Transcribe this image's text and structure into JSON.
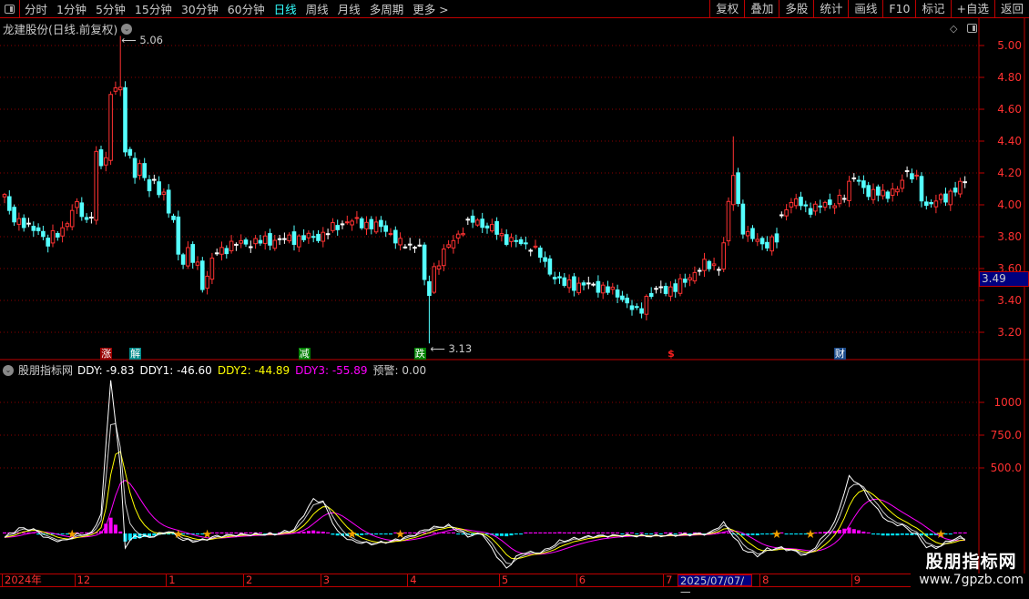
{
  "toolbar": {
    "periods": [
      "分时",
      "1分钟",
      "5分钟",
      "15分钟",
      "30分钟",
      "60分钟",
      "日线",
      "周线",
      "月线",
      "多周期",
      "更多 >"
    ],
    "active_period": "日线",
    "right_buttons": [
      "复权",
      "叠加",
      "多股",
      "统计",
      "画线",
      "F10",
      "标记",
      "+自选",
      "返回"
    ]
  },
  "main_chart": {
    "title": "龙建股份(日线.前复权)",
    "price_axis": [
      "5.00",
      "4.80",
      "4.60",
      "4.40",
      "4.20",
      "4.00",
      "3.80",
      "3.60",
      "3.40",
      "3.20"
    ],
    "current_price": "3.49",
    "high_label": "5.06",
    "low_label": "3.13",
    "signals": [
      {
        "text": "涨",
        "bar": 21,
        "bg": "#9a0000"
      },
      {
        "text": "解",
        "bar": 27,
        "bg": "#008b8b"
      },
      {
        "text": "减",
        "bar": 62,
        "bg": "#008000"
      },
      {
        "text": "跌",
        "bar": 86,
        "bg": "#008000"
      },
      {
        "text": "$",
        "bar": 138,
        "bg": "transparent"
      },
      {
        "text": "财",
        "bar": 173,
        "bg": "#1a4a8a"
      }
    ],
    "price_keyframes": [
      [
        0,
        4.05
      ],
      [
        1,
        3.95
      ],
      [
        3,
        3.9
      ],
      [
        5,
        3.85
      ],
      [
        7,
        3.85
      ],
      [
        8,
        3.8
      ],
      [
        9,
        3.75
      ],
      [
        10,
        3.8
      ],
      [
        12,
        3.85
      ],
      [
        14,
        3.95
      ],
      [
        15,
        4.0
      ],
      [
        17,
        3.9
      ],
      [
        18,
        3.95
      ],
      [
        19,
        4.3
      ],
      [
        20,
        4.25
      ],
      [
        21,
        4.3
      ],
      [
        22,
        4.7
      ],
      [
        23,
        4.75
      ],
      [
        24,
        4.7
      ],
      [
        25,
        4.35
      ],
      [
        26,
        4.3
      ],
      [
        27,
        4.2
      ],
      [
        28,
        4.25
      ],
      [
        29,
        4.15
      ],
      [
        30,
        4.1
      ],
      [
        31,
        4.15
      ],
      [
        32,
        4.1
      ],
      [
        33,
        4.05
      ],
      [
        34,
        3.95
      ],
      [
        35,
        3.9
      ],
      [
        36,
        3.7
      ],
      [
        37,
        3.65
      ],
      [
        38,
        3.7
      ],
      [
        39,
        3.65
      ],
      [
        40,
        3.62
      ],
      [
        41,
        3.5
      ],
      [
        42,
        3.55
      ],
      [
        43,
        3.65
      ],
      [
        44,
        3.7
      ],
      [
        47,
        3.75
      ],
      [
        56,
        3.78
      ],
      [
        65,
        3.8
      ],
      [
        71,
        3.9
      ],
      [
        75,
        3.88
      ],
      [
        79,
        3.85
      ],
      [
        82,
        3.75
      ],
      [
        86,
        3.75
      ],
      [
        87,
        3.5
      ],
      [
        88,
        3.45
      ],
      [
        89,
        3.6
      ],
      [
        91,
        3.7
      ],
      [
        93,
        3.78
      ],
      [
        95,
        3.85
      ],
      [
        97,
        3.9
      ],
      [
        99,
        3.88
      ],
      [
        101,
        3.85
      ],
      [
        103,
        3.8
      ],
      [
        105,
        3.78
      ],
      [
        107,
        3.75
      ],
      [
        109,
        3.75
      ],
      [
        111,
        3.68
      ],
      [
        112,
        3.62
      ],
      [
        114,
        3.55
      ],
      [
        116,
        3.5
      ],
      [
        120,
        3.5
      ],
      [
        124,
        3.48
      ],
      [
        126,
        3.45
      ],
      [
        128,
        3.42
      ],
      [
        129,
        3.38
      ],
      [
        131,
        3.32
      ],
      [
        132,
        3.35
      ],
      [
        133,
        3.42
      ],
      [
        135,
        3.46
      ],
      [
        139,
        3.48
      ],
      [
        141,
        3.52
      ],
      [
        143,
        3.58
      ],
      [
        145,
        3.62
      ],
      [
        148,
        3.62
      ],
      [
        149,
        3.75
      ],
      [
        150,
        4.0
      ],
      [
        151,
        4.2
      ],
      [
        152,
        4.0
      ],
      [
        153,
        3.85
      ],
      [
        154,
        3.8
      ],
      [
        156,
        3.78
      ],
      [
        158,
        3.75
      ],
      [
        160,
        3.78
      ],
      [
        161,
        3.92
      ],
      [
        162,
        4.0
      ],
      [
        164,
        4.02
      ],
      [
        166,
        3.98
      ],
      [
        168,
        3.98
      ],
      [
        170,
        4.0
      ],
      [
        172,
        4.02
      ],
      [
        174,
        4.05
      ],
      [
        175,
        4.12
      ],
      [
        176,
        4.2
      ],
      [
        177,
        4.15
      ],
      [
        179,
        4.05
      ],
      [
        181,
        4.1
      ],
      [
        183,
        4.05
      ],
      [
        185,
        4.1
      ],
      [
        186,
        4.18
      ],
      [
        187,
        4.2
      ],
      [
        189,
        4.15
      ],
      [
        190,
        4.05
      ],
      [
        191,
        4.0
      ],
      [
        193,
        4.02
      ],
      [
        195,
        4.05
      ],
      [
        197,
        4.1
      ],
      [
        199,
        4.14
      ]
    ],
    "extremes": {
      "high": {
        "bar": 24,
        "price": 5.06
      },
      "low": {
        "bar": 88,
        "price": 3.13
      },
      "spike": {
        "bar": 151,
        "price": 4.43
      }
    },
    "colors": {
      "up": "#ff3232",
      "down": "#54ffff",
      "flat": "#ffffff",
      "grid": "#8b0000"
    }
  },
  "indicator": {
    "name": "股朋指标网",
    "values": [
      {
        "label": "DDY: -9.83",
        "color": "#ffffff"
      },
      {
        "label": "DDY1: -46.60",
        "color": "#ffffff"
      },
      {
        "label": "DDY2: -44.89",
        "color": "#ffff00"
      },
      {
        "label": "DDY3: -55.89",
        "color": "#ff00ff"
      },
      {
        "label": "预警: 0.00",
        "color": "#cccccc"
      }
    ],
    "axis": [
      "1000",
      "750.0",
      "500.0"
    ],
    "ddy_keyframes": [
      [
        0,
        -30
      ],
      [
        3,
        40
      ],
      [
        6,
        30
      ],
      [
        9,
        -40
      ],
      [
        12,
        -60
      ],
      [
        15,
        -10
      ],
      [
        18,
        0
      ],
      [
        20,
        150
      ],
      [
        22,
        1180
      ],
      [
        24,
        500
      ],
      [
        25,
        -100
      ],
      [
        27,
        -20
      ],
      [
        30,
        -30
      ],
      [
        34,
        20
      ],
      [
        37,
        -50
      ],
      [
        40,
        -60
      ],
      [
        44,
        -20
      ],
      [
        48,
        -10
      ],
      [
        56,
        -5
      ],
      [
        60,
        30
      ],
      [
        64,
        260
      ],
      [
        66,
        240
      ],
      [
        69,
        10
      ],
      [
        72,
        -60
      ],
      [
        76,
        -80
      ],
      [
        80,
        -60
      ],
      [
        84,
        -20
      ],
      [
        88,
        40
      ],
      [
        92,
        60
      ],
      [
        96,
        -20
      ],
      [
        99,
        0
      ],
      [
        101,
        -120
      ],
      [
        104,
        -270
      ],
      [
        106,
        -180
      ],
      [
        108,
        -140
      ],
      [
        110,
        -150
      ],
      [
        112,
        -130
      ],
      [
        115,
        -60
      ],
      [
        118,
        -40
      ],
      [
        122,
        -20
      ],
      [
        128,
        -15
      ],
      [
        134,
        -20
      ],
      [
        140,
        -10
      ],
      [
        146,
        0
      ],
      [
        149,
        80
      ],
      [
        151,
        -20
      ],
      [
        153,
        -120
      ],
      [
        156,
        -170
      ],
      [
        158,
        -120
      ],
      [
        161,
        -110
      ],
      [
        164,
        -140
      ],
      [
        166,
        -170
      ],
      [
        168,
        -100
      ],
      [
        172,
        80
      ],
      [
        175,
        430
      ],
      [
        177,
        380
      ],
      [
        180,
        220
      ],
      [
        183,
        90
      ],
      [
        186,
        60
      ],
      [
        189,
        -10
      ],
      [
        191,
        -100
      ],
      [
        193,
        -110
      ],
      [
        196,
        -50
      ],
      [
        198,
        -30
      ],
      [
        199,
        -40
      ]
    ],
    "star_bars": [
      14,
      36,
      42,
      72,
      82,
      160,
      167,
      194
    ],
    "colors": {
      "ddy": "#ffffff",
      "ddy1": "#ffffff",
      "ddy2": "#ffff00",
      "ddy3": "#ff00ff",
      "pos": "#ff00ff",
      "neg": "#00e5ff",
      "star": "#f0a000"
    }
  },
  "time_axis": [
    {
      "label": "2024年",
      "bar": 0
    },
    {
      "label": "12",
      "bar": 15
    },
    {
      "label": "1",
      "bar": 34
    },
    {
      "label": "2",
      "bar": 50
    },
    {
      "label": "3",
      "bar": 66
    },
    {
      "label": "4",
      "bar": 84
    },
    {
      "label": "5",
      "bar": 103
    },
    {
      "label": "6",
      "bar": 119
    },
    {
      "label": "7",
      "bar": 137
    },
    {
      "label": "2025/07/07/一",
      "bar": 140,
      "selected": true
    },
    {
      "label": "8",
      "bar": 157
    },
    {
      "label": "9",
      "bar": 176
    }
  ],
  "watermark": {
    "name": "股朋指标网",
    "url": "www.7gpzb.com"
  }
}
